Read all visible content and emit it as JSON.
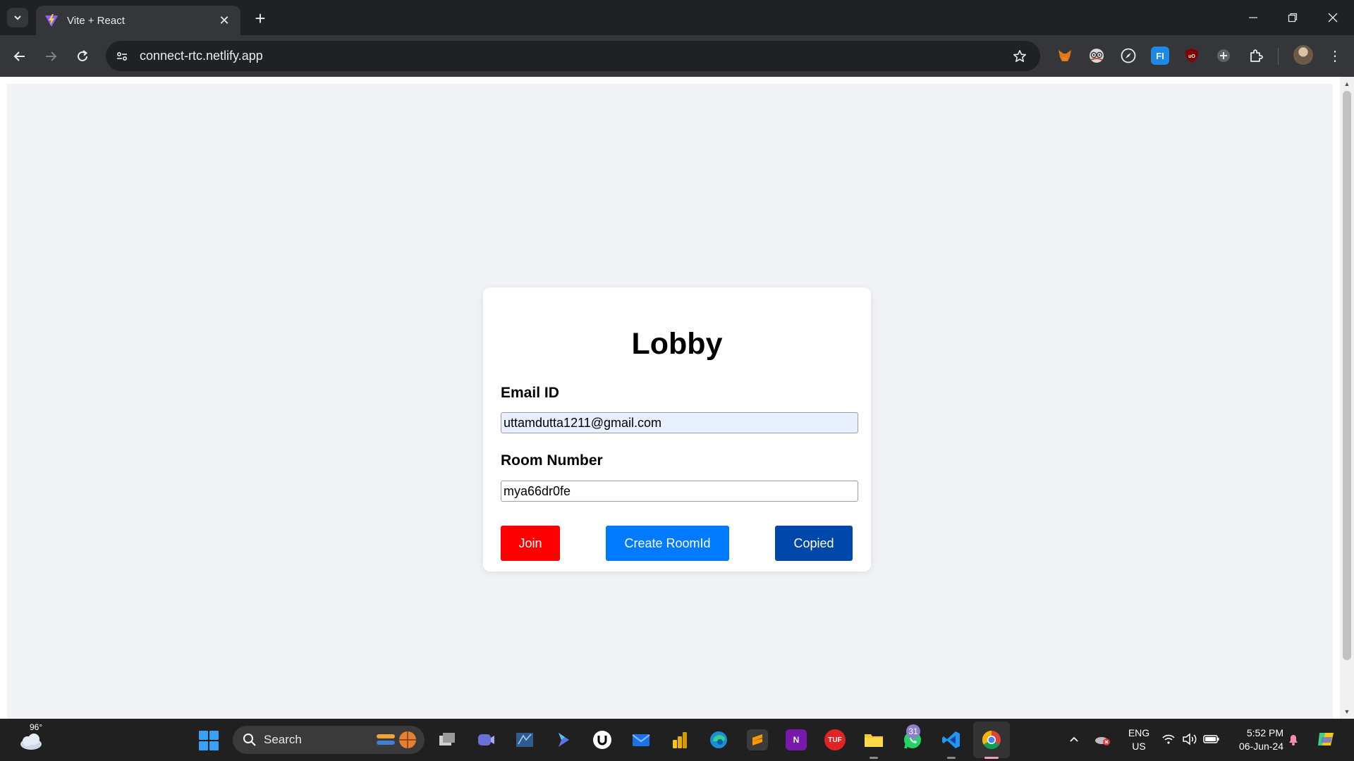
{
  "browser": {
    "tab_title": "Vite + React",
    "url": "connect-rtc.netlify.app"
  },
  "lobby": {
    "title": "Lobby",
    "email_label": "Email ID",
    "email_value": "uttamdutta1211@gmail.com",
    "room_label": "Room Number",
    "room_value": "mya66dr0fe",
    "join_label": "Join",
    "create_label": "Create RoomId",
    "copied_label": "Copied"
  },
  "taskbar": {
    "temperature": "96°",
    "search_label": "Search",
    "whatsapp_badge": "31",
    "language": "ENG",
    "region": "US",
    "time": "5:52 PM",
    "date": "06-Jun-24"
  },
  "colors": {
    "join": "#ff0000",
    "create": "#007bff",
    "copied": "#0047ab",
    "page_background": "#f0f2f5",
    "autofill_field": "#e8f0fe"
  },
  "icons": {
    "extensions": [
      "metamask-icon",
      "owl-extension-icon",
      "compass-extension-icon",
      "fi-extension-icon",
      "ublock-icon",
      "plus-extension-icon",
      "extensions-puzzle-icon"
    ],
    "taskbar_apps": [
      "task-view-icon",
      "teams-icon",
      "ssms-icon",
      "copilot-icon",
      "udemy-icon",
      "mail-icon",
      "power-bi-icon",
      "edge-icon",
      "sublime-text-icon",
      "onenote-icon",
      "tuf-icon",
      "file-explorer-icon",
      "whatsapp-icon",
      "vscode-icon",
      "chrome-icon"
    ]
  }
}
